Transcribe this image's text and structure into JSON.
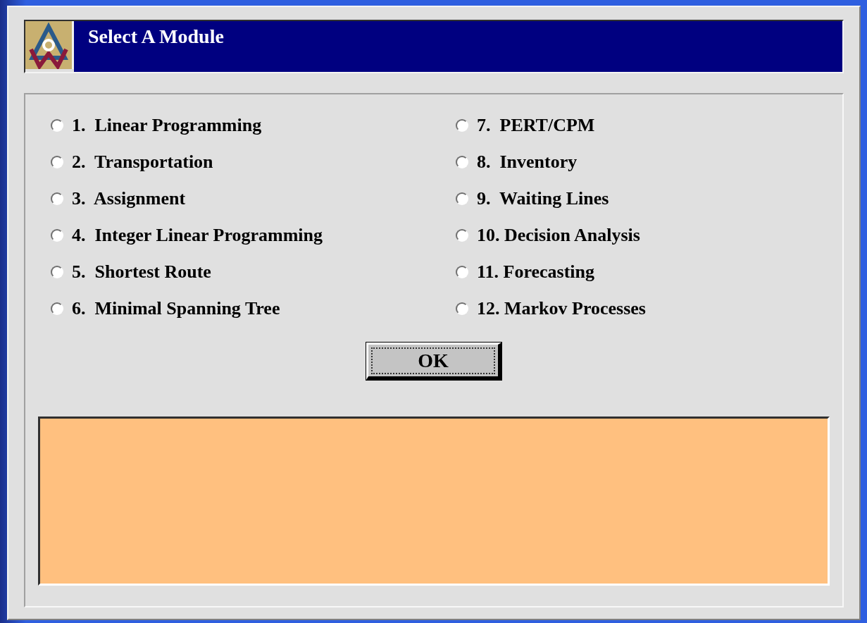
{
  "window": {
    "title": "Select A Module"
  },
  "modules": [
    {
      "label": "1.  Linear Programming",
      "selected": false
    },
    {
      "label": "2.  Transportation",
      "selected": false
    },
    {
      "label": "3.  Assignment",
      "selected": false
    },
    {
      "label": "4.  Integer Linear Programming",
      "selected": false
    },
    {
      "label": "5.  Shortest Route",
      "selected": false
    },
    {
      "label": "6.  Minimal Spanning Tree",
      "selected": false
    },
    {
      "label": "7.  PERT/CPM",
      "selected": false
    },
    {
      "label": "8.  Inventory",
      "selected": false
    },
    {
      "label": "9.  Waiting Lines",
      "selected": false
    },
    {
      "label": "10. Decision Analysis",
      "selected": false
    },
    {
      "label": "11. Forecasting",
      "selected": false
    },
    {
      "label": "12. Markov Processes",
      "selected": false
    }
  ],
  "buttons": [
    "OK"
  ]
}
